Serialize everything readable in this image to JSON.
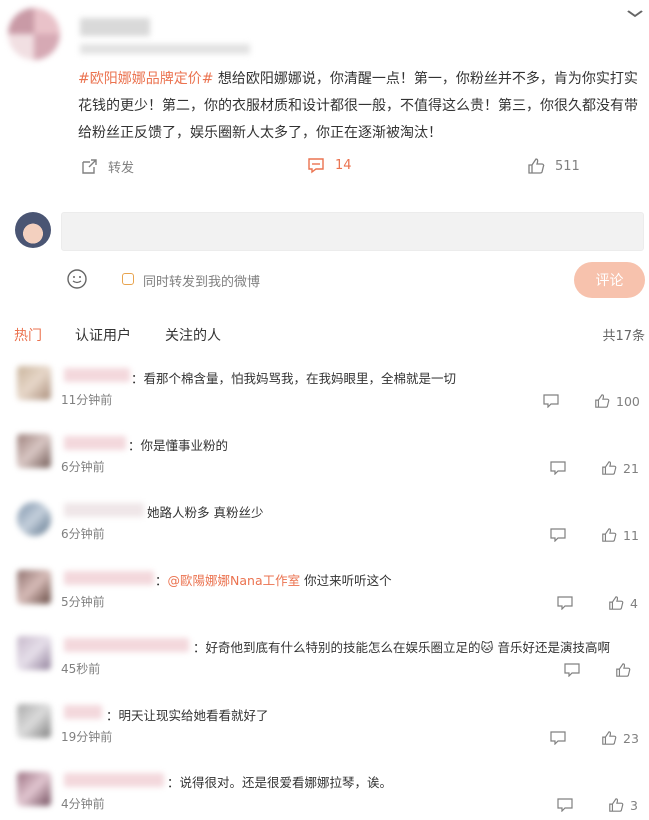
{
  "post": {
    "topic": "#欧阳娜娜品牌定价#",
    "text": " 想给欧阳娜娜说，你清醒一点！第一，你粉丝并不多，肯为你实打实花钱的更少！第二，你的衣服材质和设计都很一般，不值得这么贵！第三，你很久都没有带给粉丝正反馈了，娱乐圈新人太多了，你正在逐渐被淘汰！",
    "actions": {
      "repost": "转发",
      "comments": "14",
      "likes": "511"
    }
  },
  "composer": {
    "forward_label": "同时转发到我的微博",
    "submit_label": "评论"
  },
  "tabs": {
    "hot": "热门",
    "verified": "认证用户",
    "following": "关注的人",
    "total": "共17条"
  },
  "comments": [
    {
      "text": "：看那个棉含量，怕我妈骂我，在我妈眼里，全棉就是一切",
      "time": "11分钟前",
      "likes": "100"
    },
    {
      "text": "：你是懂事业粉的",
      "time": "6分钟前",
      "likes": "21"
    },
    {
      "text": "她路人粉多 真粉丝少",
      "time": "6分钟前",
      "likes": "11"
    },
    {
      "prefix": "：",
      "mention": "@歐陽娜娜Nana工作室",
      "suffix": " 你过来听听这个",
      "time": "5分钟前",
      "likes": "4"
    },
    {
      "text": "：好奇他到底有什么特别的技能怎么在娱乐圈立足的",
      "emoji": "🐱",
      "suffix": " 音乐好还是演技高啊",
      "time": "45秒前",
      "likes": ""
    },
    {
      "text": "：明天让现实给她看看就好了",
      "time": "19分钟前",
      "likes": "23"
    },
    {
      "text": "：说得很对。还是很爱看娜娜拉琴，诶。",
      "time": "4分钟前",
      "likes": "3"
    }
  ],
  "colors": {
    "accent": "#eb7350",
    "submit_bg": "#f7c2ad",
    "muted": "#808080"
  }
}
